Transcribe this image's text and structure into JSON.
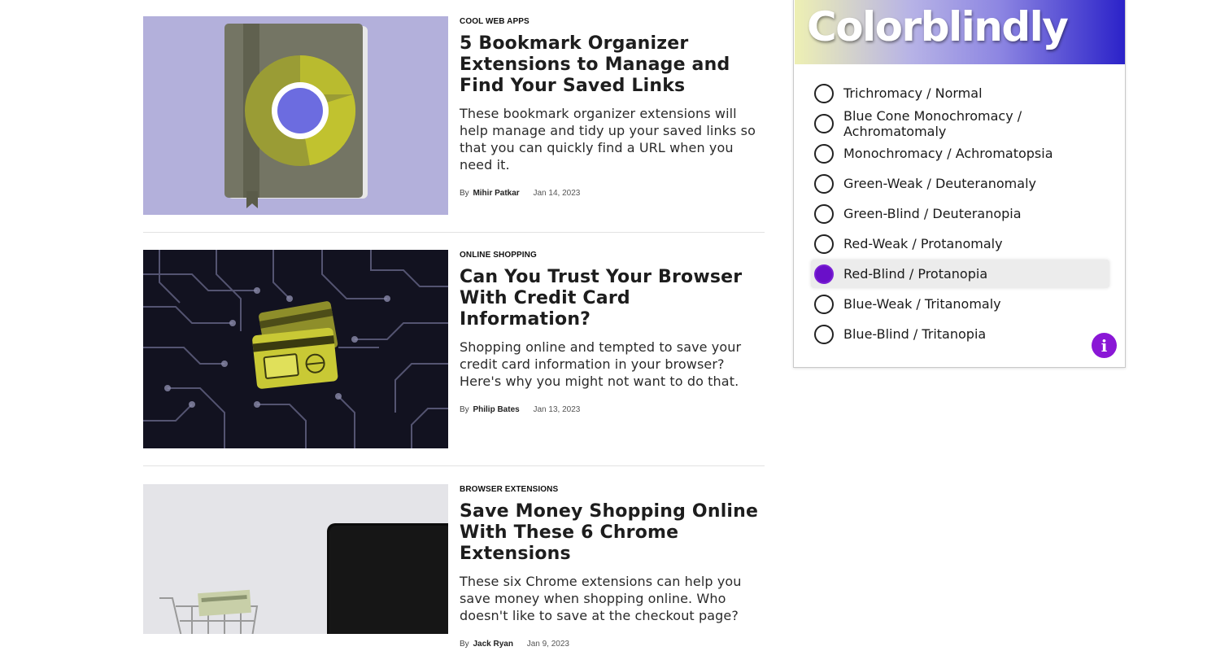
{
  "articles": [
    {
      "category": "COOL WEB APPS",
      "title": "5 Bookmark Organizer Extensions to Manage and Find Your Saved Links",
      "excerpt": "These bookmark organizer extensions will help manage and tidy up your saved links so that you can quickly find a URL when you need it.",
      "by": "By",
      "author": "Mihir Patkar",
      "date": "Jan 14, 2023",
      "image_icon": "bookmark-book-chrome-icon"
    },
    {
      "category": "ONLINE SHOPPING",
      "title": "Can You Trust Your Browser With Credit Card Information?",
      "excerpt": "Shopping online and tempted to save your credit card information in your browser? Here's why you might not want to do that.",
      "by": "By",
      "author": "Philip Bates",
      "date": "Jan 13, 2023",
      "image_icon": "credit-card-circuit-icon"
    },
    {
      "category": "BROWSER EXTENSIONS",
      "title": "Save Money Shopping Online With These 6 Chrome Extensions",
      "excerpt": "These six Chrome extensions can help you save money when shopping online. Who doesn't like to save at the checkout page?",
      "by": "By",
      "author": "Jack Ryan",
      "date": "Jan 9, 2023",
      "image_icon": "shopping-cart-laptop-icon"
    }
  ],
  "colorblindly": {
    "title": "Colorblindly",
    "options": [
      {
        "label": "Trichromacy / Normal",
        "selected": false
      },
      {
        "label": "Blue Cone Monochromacy / Achromatomaly",
        "selected": false
      },
      {
        "label": "Monochromacy / Achromatopsia",
        "selected": false
      },
      {
        "label": "Green-Weak / Deuteranomaly",
        "selected": false
      },
      {
        "label": "Green-Blind / Deuteranopia",
        "selected": false
      },
      {
        "label": "Red-Weak / Protanomaly",
        "selected": false
      },
      {
        "label": "Red-Blind / Protanopia",
        "selected": true
      },
      {
        "label": "Blue-Weak / Tritanomaly",
        "selected": false
      },
      {
        "label": "Blue-Blind / Tritanopia",
        "selected": false
      }
    ],
    "info_label": "i",
    "accent_color": "#8a17d6"
  }
}
